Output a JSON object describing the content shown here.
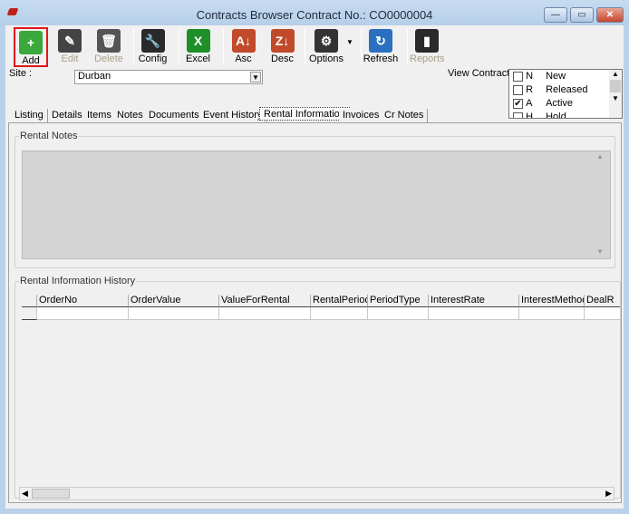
{
  "window": {
    "title": "Contracts Browser Contract No.: CO0000004",
    "minimize": "—",
    "maximize": "▭",
    "close": "✕"
  },
  "toolbar": [
    {
      "label": "Add",
      "icon": "plus-icon",
      "enabled": true,
      "color": "#3aa83a"
    },
    {
      "label": "Edit",
      "icon": "edit-icon",
      "enabled": false,
      "color": "#444444"
    },
    {
      "label": "Delete",
      "icon": "trash-icon",
      "enabled": false,
      "color": "#555555"
    },
    {
      "label": "Config",
      "icon": "wrench-icon",
      "enabled": true,
      "color": "#2a2a2a"
    },
    {
      "label": "Excel",
      "icon": "excel-icon",
      "enabled": true,
      "color": "#1f8f2a"
    },
    {
      "label": "Asc",
      "icon": "sort-asc-icon",
      "enabled": true,
      "color": "#c04a2a"
    },
    {
      "label": "Desc",
      "icon": "sort-desc-icon",
      "enabled": true,
      "color": "#c04a2a"
    },
    {
      "label": "Options",
      "icon": "gear-icon",
      "enabled": true,
      "color": "#333333"
    },
    {
      "label": "Refresh",
      "icon": "refresh-icon",
      "enabled": true,
      "color": "#2a6fc0"
    },
    {
      "label": "Reports",
      "icon": "reports-icon",
      "enabled": false,
      "color": "#2a2a2a"
    }
  ],
  "site": {
    "label": "Site :",
    "value": "Durban"
  },
  "view_contracts": {
    "label": "View Contracts:",
    "items": [
      {
        "code": "N",
        "label": "New",
        "checked": false
      },
      {
        "code": "R",
        "label": "Released",
        "checked": false
      },
      {
        "code": "A",
        "label": "Active",
        "checked": true
      },
      {
        "code": "H",
        "label": "Hold",
        "checked": false
      }
    ]
  },
  "tabs": [
    "Listing",
    "Details",
    "Items",
    "Notes",
    "Documents",
    "Event History",
    "Rental Information",
    "Invoices",
    "Cr Notes"
  ],
  "active_tab": "Rental Information",
  "rental_notes": {
    "label": "Rental Notes",
    "value": ""
  },
  "history": {
    "label": "Rental Information History",
    "columns": [
      "OrderNo",
      "OrderValue",
      "ValueForRental",
      "RentalPeriod",
      "PeriodType",
      "InterestRate",
      "InterestMethod",
      "DealR"
    ]
  }
}
